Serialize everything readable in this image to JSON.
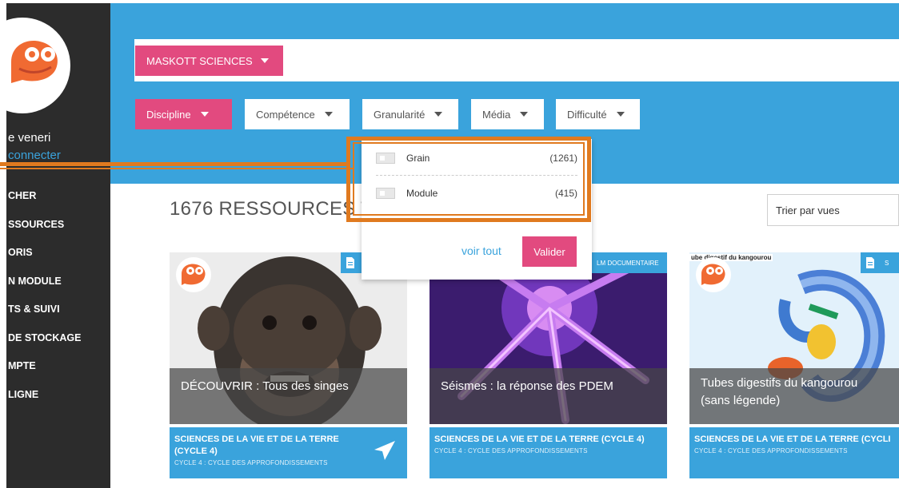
{
  "user": {
    "name": "e veneri",
    "connect_label": "connecter"
  },
  "nav": [
    "CHER",
    "SSOURCES",
    "ORIS",
    "N MODULE",
    "TS & SUIVI",
    "DE STOCKAGE",
    "MPTE",
    "LIGNE"
  ],
  "header": {
    "collection_button": "MASKOTT SCIENCES",
    "filters": [
      "Discipline",
      "Compétence",
      "Granularité",
      "Média",
      "Difficulté"
    ]
  },
  "dropdown": {
    "options": [
      {
        "label": "Grain",
        "count": "(1261)"
      },
      {
        "label": "Module",
        "count": "(415)"
      }
    ],
    "see_all": "voir tout",
    "validate": "Valider"
  },
  "results": {
    "count_label": "1676 RESSOURCES T",
    "sort_label": "Trier par vues"
  },
  "cards": [
    {
      "type_label": "",
      "title": "DÉCOUVRIR : Tous des singes",
      "discipline": "SCIENCES DE LA VIE ET DE LA TERRE (CYCLE 4)",
      "cycle": "CYCLE 4 : CYCLE DES APPROFONDISSEMENTS"
    },
    {
      "type_label": "LM DOCUMENTAIRE",
      "title": "Séismes : la réponse des PDEM",
      "discipline": "SCIENCES DE LA VIE ET DE LA TERRE (CYCLE 4)",
      "cycle": "CYCLE 4 : CYCLE DES APPROFONDISSEMENTS"
    },
    {
      "type_label": "S",
      "image_caption": "ube digestif du kangourou",
      "title": "Tubes digestifs du kangourou (sans légende)",
      "discipline": "SCIENCES DE LA VIE ET DE LA TERRE (CYCLI",
      "cycle": "CYCLE 4 : CYCLE DES APPROFONDISSEMENTS"
    }
  ],
  "colors": {
    "brand_blue": "#3aa3dc",
    "brand_pink": "#e24a7f",
    "sidebar": "#2c2c2c",
    "annotation": "#e07a1f"
  },
  "icons": [
    "maskott-mascot-logo",
    "caret-down-icon",
    "document-icon",
    "paper-plane-icon"
  ]
}
